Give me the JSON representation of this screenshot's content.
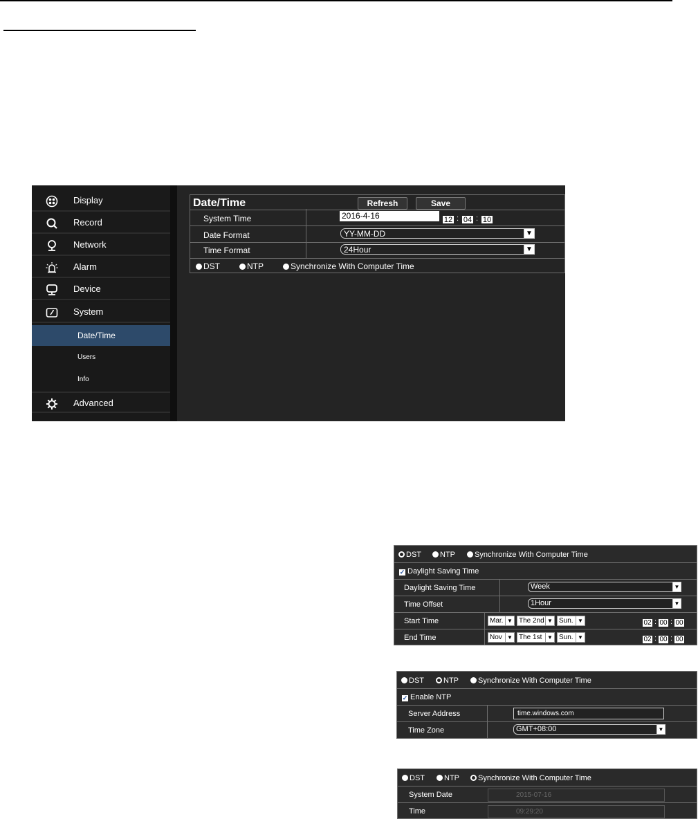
{
  "sidebar": {
    "items": [
      {
        "label": "Display",
        "icon": "display-icon"
      },
      {
        "label": "Record",
        "icon": "search-icon"
      },
      {
        "label": "Network",
        "icon": "network-icon"
      },
      {
        "label": "Alarm",
        "icon": "alarm-icon"
      },
      {
        "label": "Device",
        "icon": "monitor-icon"
      },
      {
        "label": "System",
        "icon": "system-icon"
      }
    ],
    "sub_items": [
      {
        "label": "Date/Time",
        "active": true
      },
      {
        "label": "Users",
        "active": false
      },
      {
        "label": "Info",
        "active": false
      }
    ],
    "advanced": {
      "label": "Advanced",
      "icon": "gear-icon"
    },
    "active_color": "#2d4a6a"
  },
  "datetime": {
    "title": "Date/Time",
    "refresh_label": "Refresh",
    "save_label": "Save",
    "system_time_label": "System Time",
    "system_date_value": "2016-4-16",
    "hour": "12",
    "minute": "04",
    "second": "10",
    "date_format_label": "Date Format",
    "date_format_value": "YY-MM-DD",
    "time_format_label": "Time Format",
    "time_format_value": "24Hour",
    "radio_dst": "DST",
    "radio_ntp": "NTP",
    "radio_sync": "Synchronize With Computer Time"
  },
  "dst_panel": {
    "radio_dst": "DST",
    "radio_ntp": "NTP",
    "radio_sync": "Synchronize With Computer Time",
    "checkbox_label": "Daylight Saving Time",
    "dst_label": "Daylight Saving Time",
    "dst_value": "Week",
    "offset_label": "Time Offset",
    "offset_value": "1Hour",
    "start_label": "Start Time",
    "start_month": "Mar.",
    "start_week": "The 2nd",
    "start_day": "Sun.",
    "start_hh": "02",
    "start_mm": "00",
    "start_ss": "00",
    "end_label": "End Time",
    "end_month": "Nov",
    "end_week": "The 1st",
    "end_day": "Sun.",
    "end_hh": "02",
    "end_mm": "00",
    "end_ss": "00"
  },
  "ntp_panel": {
    "radio_dst": "DST",
    "radio_ntp": "NTP",
    "radio_sync": "Synchronize With Computer Time",
    "checkbox_label": "Enable NTP",
    "server_label": "Server Address",
    "server_value": "time.windows.com",
    "zone_label": "Time Zone",
    "zone_value": "GMT+08:00"
  },
  "sync_panel": {
    "radio_dst": "DST",
    "radio_ntp": "NTP",
    "radio_sync": "Synchronize With Computer Time",
    "date_label": "System Date",
    "date_value": "2015-07-16",
    "time_label": "Time",
    "time_value": "09:29:20"
  }
}
